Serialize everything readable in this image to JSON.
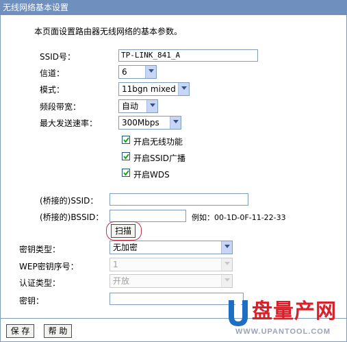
{
  "window": {
    "title": "无线网络基本设置"
  },
  "description": "本页面设置路由器无线网络的基本参数。",
  "form": {
    "ssid": {
      "label": "SSID号：",
      "value": "TP-LINK_841_A"
    },
    "channel": {
      "label": "信道：",
      "value": "6"
    },
    "mode": {
      "label": "模式：",
      "value": "11bgn mixed"
    },
    "bandwidth": {
      "label": "频段带宽：",
      "value": "自动"
    },
    "max_rate": {
      "label": "最大发送速率：",
      "value": "300Mbps"
    },
    "enable_wireless": {
      "label": "开启无线功能",
      "checked": true
    },
    "enable_ssid_broadcast": {
      "label": "开启SSID广播",
      "checked": true
    },
    "enable_wds": {
      "label": "开启WDS",
      "checked": true
    },
    "bridge_ssid": {
      "label": "(桥接的)SSID：",
      "value": ""
    },
    "bridge_bssid": {
      "label": "(桥接的)BSSID：",
      "value": "",
      "example": "例如：00-1D-0F-11-22-33"
    },
    "scan_button": "扫描",
    "key_type": {
      "label": "密钥类型：",
      "value": "无加密"
    },
    "wep_index": {
      "label": "WEP密钥序号：",
      "value": "1"
    },
    "auth_type": {
      "label": "认证类型：",
      "value": "开放"
    },
    "key": {
      "label": "密钥：",
      "value": ""
    }
  },
  "footer": {
    "save": "保 存",
    "help": "帮 助"
  },
  "watermark": {
    "brand": "盘量产网",
    "url": "WWW.UPANTOOL.COM"
  },
  "colors": {
    "titlebar": "#6f8fbe",
    "scan_highlight": "#c0304a",
    "logo_blue": "#1d6fc4",
    "logo_red": "#d8202a"
  }
}
